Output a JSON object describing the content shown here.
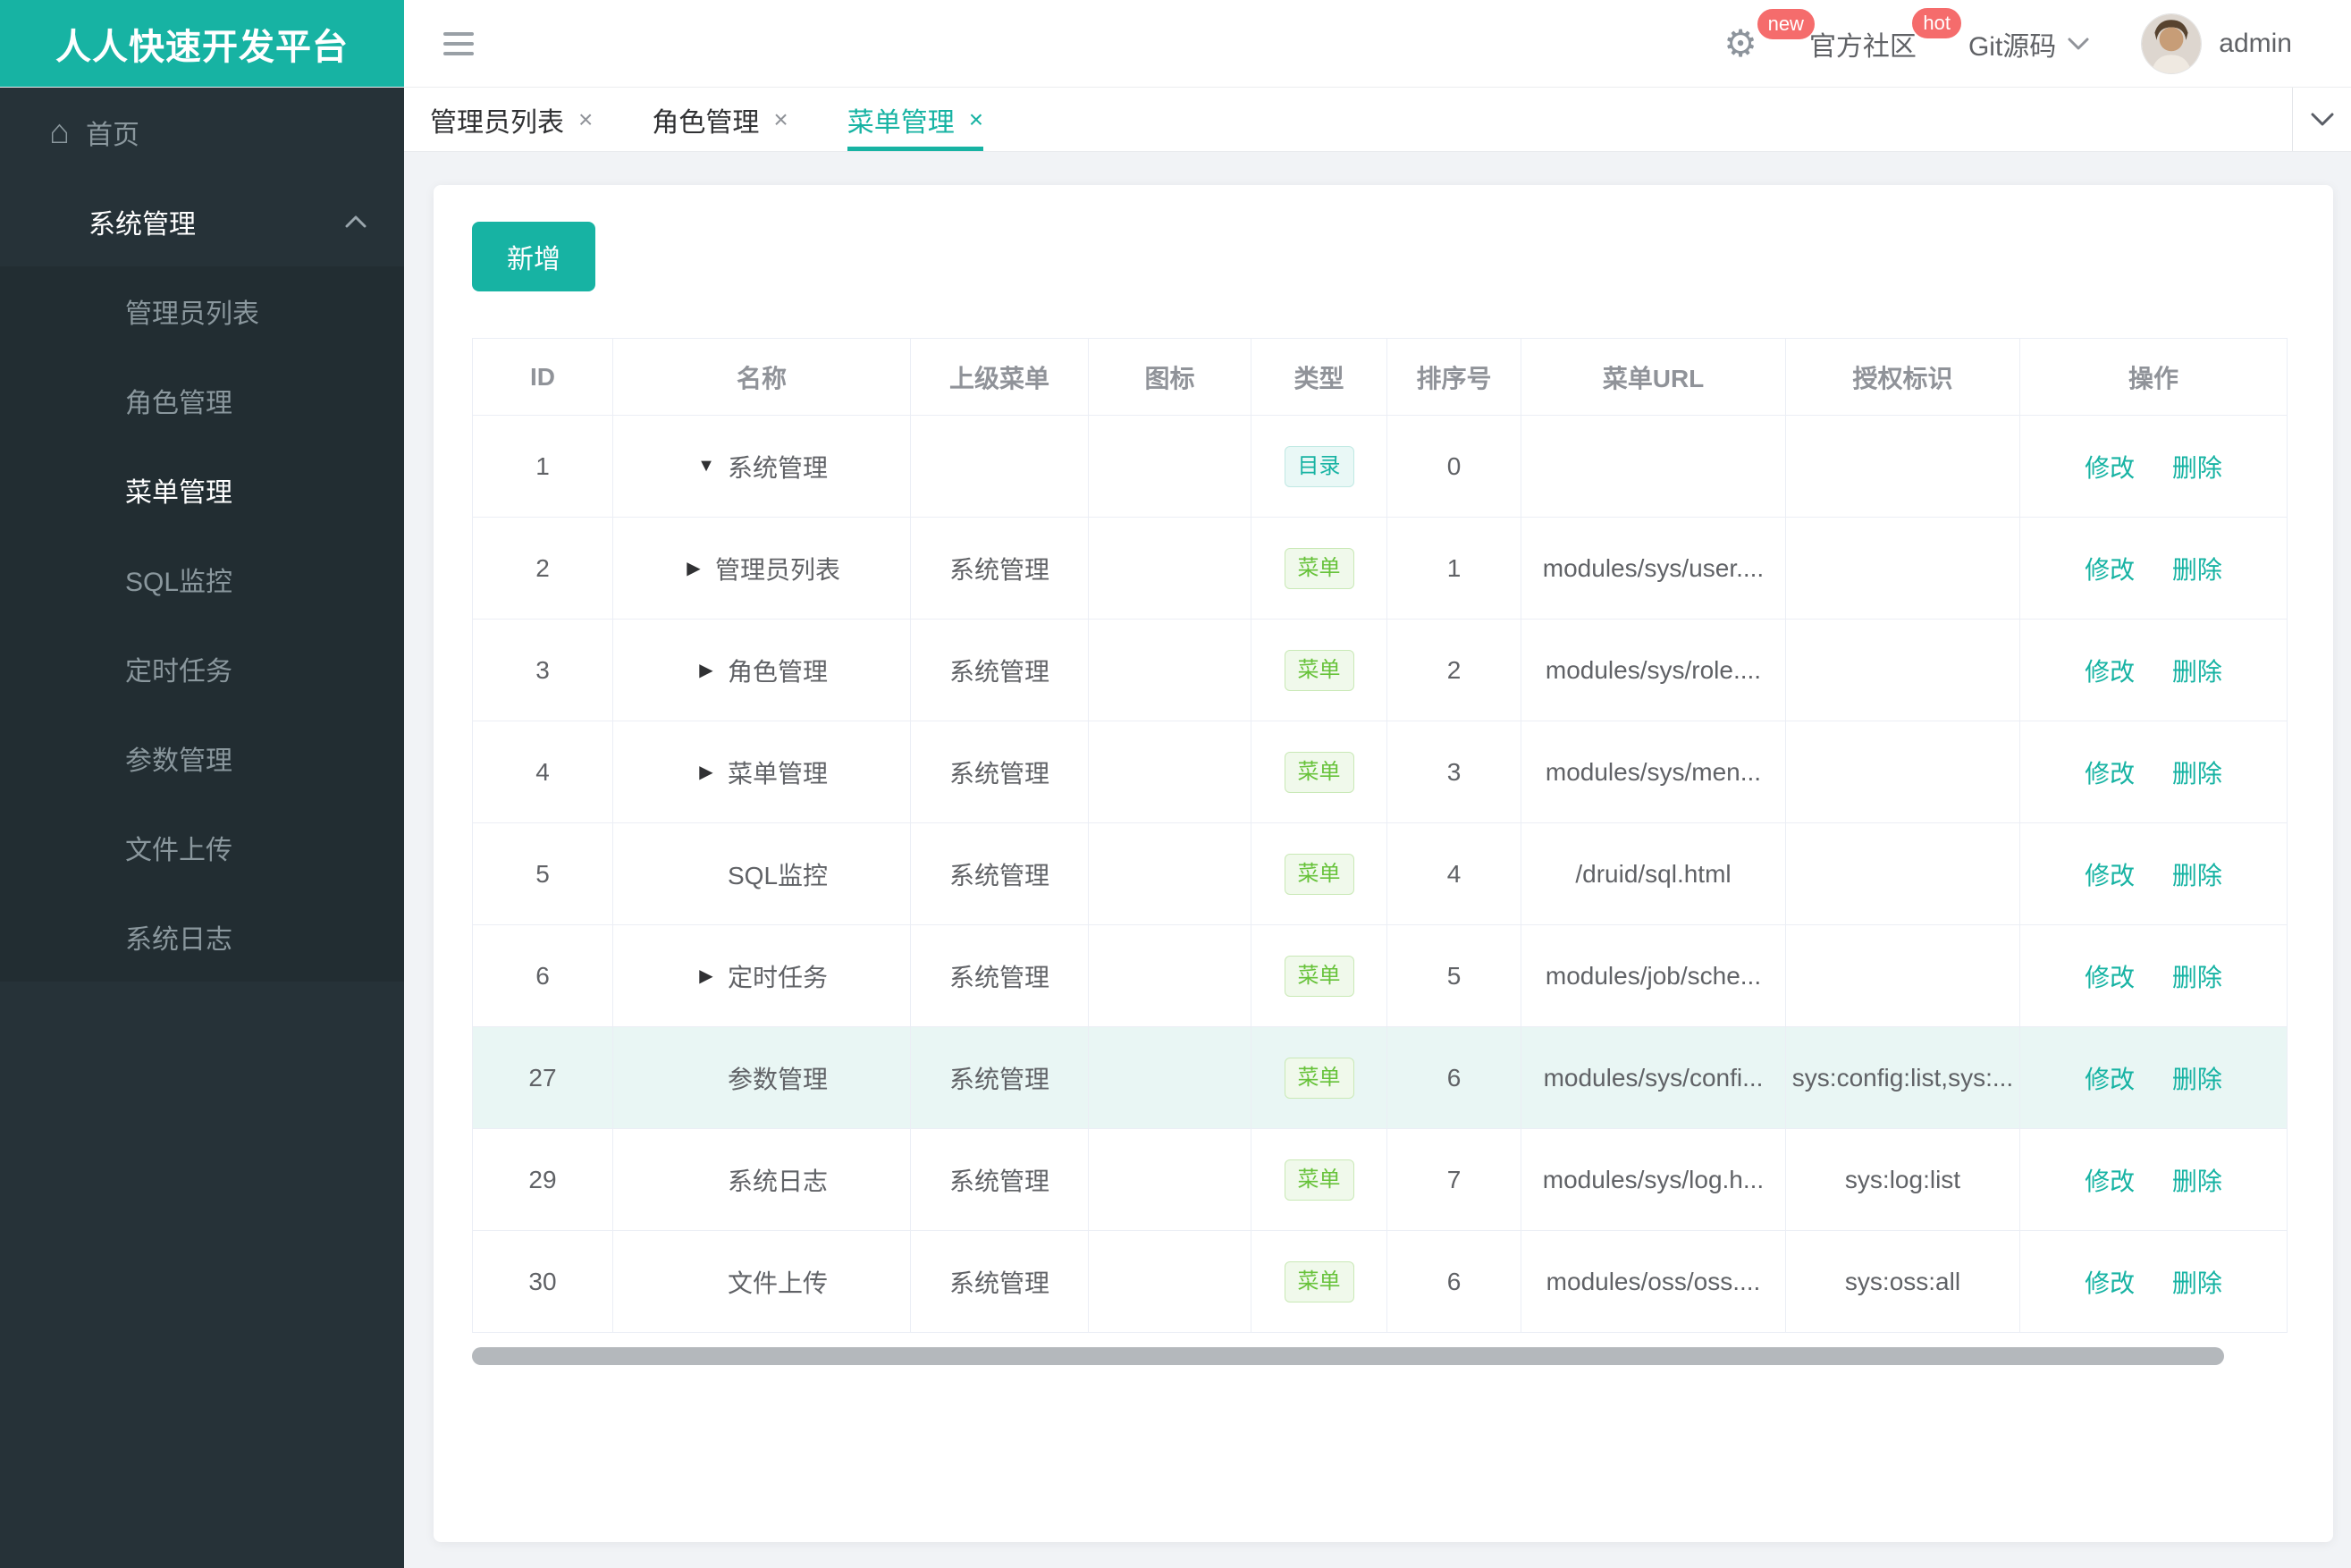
{
  "brand": {
    "title": "人人快速开发平台"
  },
  "colors": {
    "accent": "#17b3a3",
    "badge": "#f56c6c",
    "sidebar_bg": "#263238",
    "submenu_bg": "#222d32",
    "highlight_row": "#e9f6f4",
    "tag_dir": "#17b3a3",
    "tag_menu": "#67c23a"
  },
  "icons": {
    "close": "×",
    "gear": "⚙",
    "home": "⌂",
    "tree_down": "▼",
    "tree_right": "▶"
  },
  "topbar": {
    "settings_badge": "new",
    "community_label": "官方社区",
    "community_badge": "hot",
    "git_label": "Git源码",
    "user": "admin"
  },
  "sidebar": {
    "home": "首页",
    "group": {
      "label": "系统管理",
      "items": [
        {
          "label": "管理员列表",
          "active": false
        },
        {
          "label": "角色管理",
          "active": false
        },
        {
          "label": "菜单管理",
          "active": true
        },
        {
          "label": "SQL监控",
          "active": false
        },
        {
          "label": "定时任务",
          "active": false
        },
        {
          "label": "参数管理",
          "active": false
        },
        {
          "label": "文件上传",
          "active": false
        },
        {
          "label": "系统日志",
          "active": false
        }
      ]
    }
  },
  "tabs": [
    {
      "label": "管理员列表",
      "active": false
    },
    {
      "label": "角色管理",
      "active": false
    },
    {
      "label": "菜单管理",
      "active": true
    }
  ],
  "toolbar": {
    "add_label": "新增"
  },
  "table": {
    "columns": [
      "ID",
      "名称",
      "上级菜单",
      "图标",
      "类型",
      "排序号",
      "菜单URL",
      "授权标识",
      "操作"
    ],
    "actions": {
      "edit": "修改",
      "delete": "删除"
    },
    "rows": [
      {
        "id": "1",
        "arrow": "down",
        "name": "系统管理",
        "parent": "",
        "icon": "",
        "type": {
          "label": "目录",
          "kind": "dir"
        },
        "order": "0",
        "url": "",
        "perm": "",
        "highlight": false
      },
      {
        "id": "2",
        "arrow": "right",
        "name": "管理员列表",
        "parent": "系统管理",
        "icon": "",
        "type": {
          "label": "菜单",
          "kind": "menu"
        },
        "order": "1",
        "url": "modules/sys/user....",
        "perm": "",
        "highlight": false
      },
      {
        "id": "3",
        "arrow": "right",
        "name": "角色管理",
        "parent": "系统管理",
        "icon": "",
        "type": {
          "label": "菜单",
          "kind": "menu"
        },
        "order": "2",
        "url": "modules/sys/role....",
        "perm": "",
        "highlight": false
      },
      {
        "id": "4",
        "arrow": "right",
        "name": "菜单管理",
        "parent": "系统管理",
        "icon": "",
        "type": {
          "label": "菜单",
          "kind": "menu"
        },
        "order": "3",
        "url": "modules/sys/men...",
        "perm": "",
        "highlight": false
      },
      {
        "id": "5",
        "arrow": "",
        "name": "SQL监控",
        "parent": "系统管理",
        "icon": "",
        "type": {
          "label": "菜单",
          "kind": "menu"
        },
        "order": "4",
        "url": "/druid/sql.html",
        "perm": "",
        "highlight": false
      },
      {
        "id": "6",
        "arrow": "right",
        "name": "定时任务",
        "parent": "系统管理",
        "icon": "",
        "type": {
          "label": "菜单",
          "kind": "menu"
        },
        "order": "5",
        "url": "modules/job/sche...",
        "perm": "",
        "highlight": false
      },
      {
        "id": "27",
        "arrow": "",
        "name": "参数管理",
        "parent": "系统管理",
        "icon": "",
        "type": {
          "label": "菜单",
          "kind": "menu"
        },
        "order": "6",
        "url": "modules/sys/confi...",
        "perm": "sys:config:list,sys:...",
        "highlight": true
      },
      {
        "id": "29",
        "arrow": "",
        "name": "系统日志",
        "parent": "系统管理",
        "icon": "",
        "type": {
          "label": "菜单",
          "kind": "menu"
        },
        "order": "7",
        "url": "modules/sys/log.h...",
        "perm": "sys:log:list",
        "highlight": false
      },
      {
        "id": "30",
        "arrow": "",
        "name": "文件上传",
        "parent": "系统管理",
        "icon": "",
        "type": {
          "label": "菜单",
          "kind": "menu"
        },
        "order": "6",
        "url": "modules/oss/oss....",
        "perm": "sys:oss:all",
        "highlight": false
      }
    ]
  }
}
